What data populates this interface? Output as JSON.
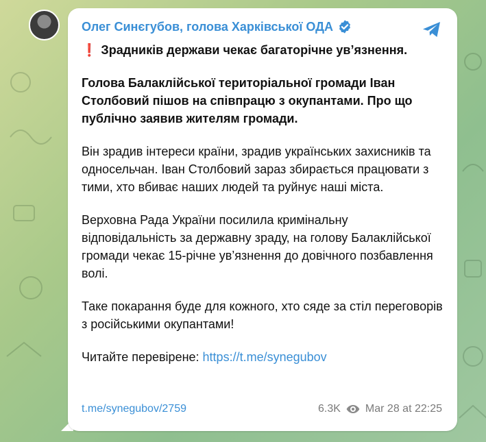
{
  "channel": {
    "name": "Олег Синєгубов, голова Харківської ОДА",
    "verified_icon": "verified-badge-icon",
    "share_icon": "telegram-share-icon",
    "accent": "#3a8fd6"
  },
  "post": {
    "headline_emoji": "❗",
    "headline": "Зрадників держави чекає багаторічне ув’язнення.",
    "para1": "Голова Балаклійської територіальної громади Іван Столбовий пішов на співпрацю з окупантами. Про що публічно заявив жителям громади.",
    "para2": "Він зрадив інтереси країни, зрадив українських захисників та односельчан. Іван Столбовий зараз збирається працювати з тими, хто вбиває наших людей та руйнує наші міста.",
    "para3": "Верховна Рада України посилила кримінальну відповідальність за державну зраду, на голову Балаклійської громади чекає 15-річне ув’язнення до довічного позбавлення волі.",
    "para4": "Таке покарання буде для кожного, хто сяде за стіл переговорів з російськими окупантами!",
    "read_label": "Читайте перевірене:",
    "read_link": "https://t.me/synegubov"
  },
  "footer": {
    "post_link": "t.me/synegubov/2759",
    "views": "6.3K",
    "views_icon": "eye-icon",
    "timestamp": "Mar 28 at 22:25"
  }
}
